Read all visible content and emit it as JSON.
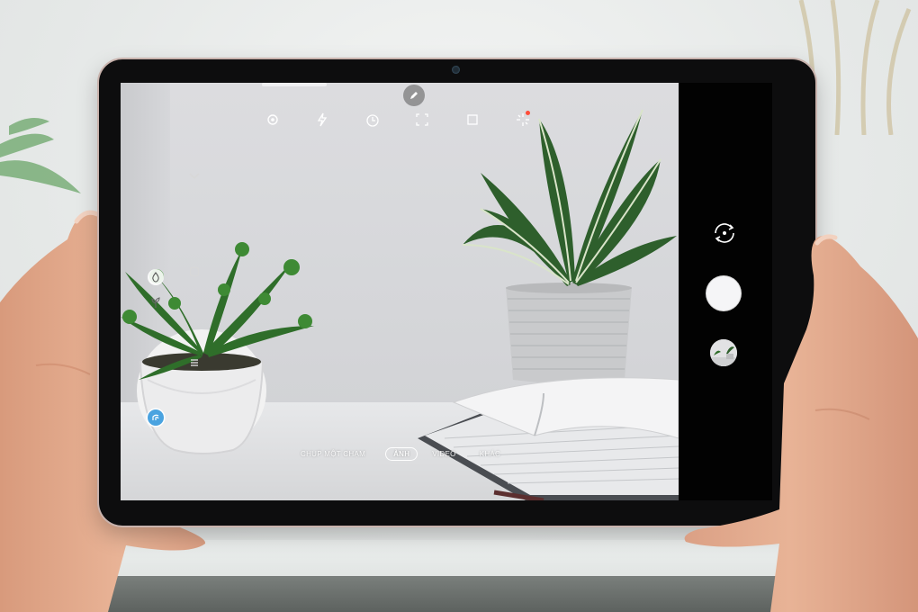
{
  "camera": {
    "modes": [
      "CHỤP MỘT CHẠM",
      "ẢNH",
      "VIDEO",
      "KHÁC"
    ],
    "active_mode": "ẢNH"
  },
  "icons": {
    "top_bar": [
      "settings-icon",
      "flash-icon",
      "timer-icon",
      "aspect-ratio-icon",
      "picture-size-icon",
      "filter-effects-icon"
    ],
    "side": [
      "water-drop-icon",
      "plant-icon",
      "scene-optimizer-icon"
    ],
    "controls": [
      "chevron-down-icon",
      "switch-camera-icon",
      "shutter-button",
      "square-icon",
      "gallery-thumbnail",
      "menu-icon"
    ]
  },
  "colors": {
    "tablet_body": "#0d0d0e",
    "tablet_frame": "#c9b3ad",
    "shutter": "#f5f5f7",
    "notification_dot": "#ff4d3a",
    "scene_optimizer": "#4aa3e0"
  }
}
